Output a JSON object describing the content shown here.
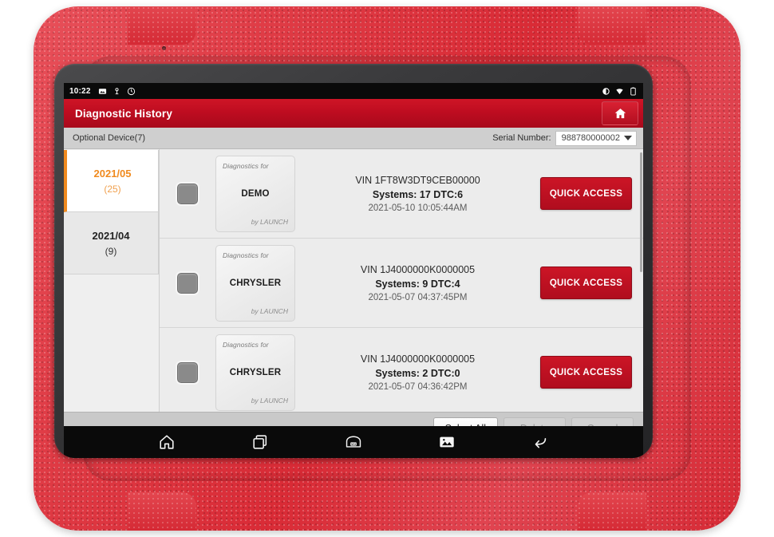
{
  "status_bar": {
    "time": "10:22",
    "left_icons": [
      "image-icon",
      "location-icon",
      "screenshot-icon"
    ],
    "right_icons": [
      "brightness-icon",
      "wifi-icon",
      "battery-icon"
    ]
  },
  "title_bar": {
    "title": "Diagnostic History",
    "home_icon": "home-icon",
    "background_color": "#bd0c20"
  },
  "sub_bar": {
    "device_label": "Optional Device(7)",
    "serial_label": "Serial Number:",
    "serial_value": "988780000002",
    "dropdown_icon": "chevron-down-icon"
  },
  "sidebar": {
    "months": [
      {
        "name": "2021/05",
        "count": "(25)",
        "active": true
      },
      {
        "name": "2021/04",
        "count": "(9)",
        "active": false
      }
    ],
    "active_color": "#f08a1e"
  },
  "records": [
    {
      "checkbox_state": "unchecked",
      "card_top": "Diagnostics for",
      "card_brand": "DEMO",
      "card_bottom": "by LAUNCH",
      "vin": "VIN 1FT8W3DT9CEB00000",
      "systems": "Systems: 17 DTC:6",
      "timestamp": "2021-05-10 10:05:44AM",
      "action_label": "QUICK ACCESS"
    },
    {
      "checkbox_state": "unchecked",
      "card_top": "Diagnostics for",
      "card_brand": "CHRYSLER",
      "card_bottom": "by LAUNCH",
      "vin": "VIN 1J4000000K0000005",
      "systems": "Systems: 9 DTC:4",
      "timestamp": "2021-05-07 04:37:45PM",
      "action_label": "QUICK ACCESS"
    },
    {
      "checkbox_state": "unchecked",
      "card_top": "Diagnostics for",
      "card_brand": "CHRYSLER",
      "card_bottom": "by LAUNCH",
      "vin": "VIN 1J4000000K0000005",
      "systems": "Systems: 2 DTC:0",
      "timestamp": "2021-05-07 04:36:42PM",
      "action_label": "QUICK ACCESS"
    }
  ],
  "action_bar": {
    "select_all": "Select All",
    "delete": "Delete",
    "cancel": "Cancel"
  },
  "nav_bar": {
    "items": [
      "home-icon",
      "recent-apps-icon",
      "vci-connector-icon",
      "screenshot-icon",
      "back-icon"
    ]
  }
}
